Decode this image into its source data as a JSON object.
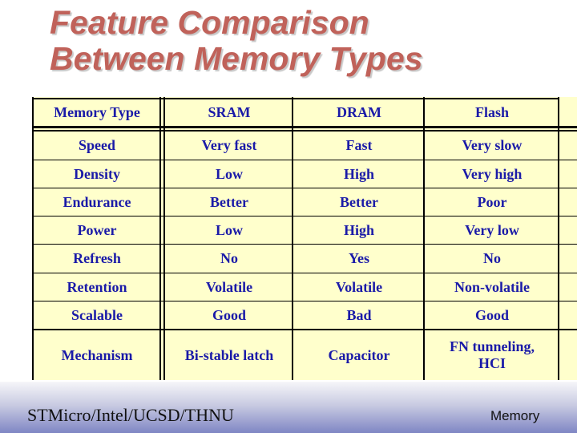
{
  "slide": {
    "title_line1": "Feature Comparison",
    "title_line2": "Between Memory Types",
    "footer_left": "STMicro/Intel/UCSD/THNU",
    "footer_right": "Memory"
  },
  "colors": {
    "title": "#c0625a",
    "table_background": "#ffffcc",
    "table_text": "#1a1aa8",
    "footer_gradient_end": "#7f86c4"
  },
  "table": {
    "headers": [
      "Memory Type",
      "SRAM",
      "DRAM",
      "Flash"
    ],
    "rows": [
      [
        "Speed",
        "Very fast",
        "Fast",
        "Very slow"
      ],
      [
        "Density",
        "Low",
        "High",
        "Very high"
      ],
      [
        "Endurance",
        "Better",
        "Better",
        "Poor"
      ],
      [
        "Power",
        "Low",
        "High",
        "Very low"
      ],
      [
        "Refresh",
        "No",
        "Yes",
        "No"
      ],
      [
        "Retention",
        "Volatile",
        "Volatile",
        "Non-volatile"
      ],
      [
        "Scalable",
        "Good",
        "Bad",
        "Good"
      ],
      [
        "Mechanism",
        "Bi-stable latch",
        "Capacitor",
        "FN tunneling, HCI"
      ]
    ]
  }
}
